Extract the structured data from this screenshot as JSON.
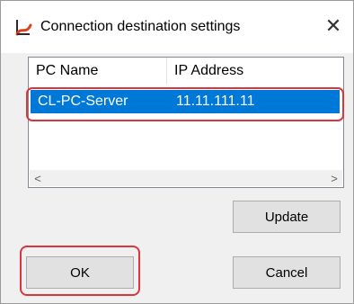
{
  "window": {
    "title": "Connection destination settings",
    "close_label": "✕",
    "icon": "app-logo-icon"
  },
  "list": {
    "columns": [
      "PC Name",
      "IP Address"
    ],
    "rows": [
      {
        "pc_name": "CL-PC-Server",
        "ip_address": "11.11.111.11",
        "selected": true
      }
    ],
    "scroll_left": "<",
    "scroll_right": ">"
  },
  "buttons": {
    "update": "Update",
    "ok": "OK",
    "cancel": "Cancel"
  },
  "colors": {
    "selection": "#0078d7",
    "highlight": "#d9363e"
  }
}
